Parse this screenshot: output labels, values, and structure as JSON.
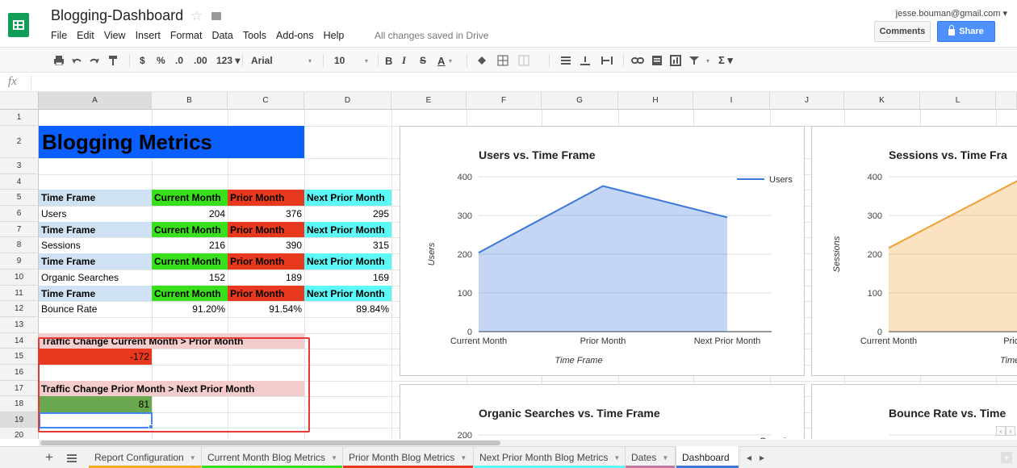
{
  "app": {
    "title": "Blogging-Dashboard",
    "star_icon": "star-icon",
    "folder_icon": "folder-icon",
    "menus": [
      "File",
      "Edit",
      "View",
      "Insert",
      "Format",
      "Data",
      "Tools",
      "Add-ons",
      "Help"
    ],
    "save_status": "All changes saved in Drive",
    "account_email": "jesse.bouman@gmail.com ▾",
    "comments_label": "Comments",
    "share_label": "Share"
  },
  "toolbar": {
    "currency": "$",
    "percent": "%",
    "decimal_less": ".0",
    "decimal_more": ".00",
    "number_format": "123 ▾",
    "font": "Arial",
    "font_size": "10",
    "bold": "B",
    "italic": "I",
    "strike": "S",
    "text_color": "A",
    "sum": "Σ ▾"
  },
  "formula_bar": {
    "label": "fx",
    "value": ""
  },
  "columns": [
    "A",
    "B",
    "C",
    "D",
    "E",
    "F",
    "G",
    "H",
    "I",
    "J",
    "K",
    "L"
  ],
  "rows": [
    "1",
    "2",
    "3",
    "4",
    "5",
    "6",
    "7",
    "8",
    "9",
    "10",
    "11",
    "12",
    "13",
    "14",
    "15",
    "16",
    "17",
    "18",
    "19",
    "20"
  ],
  "colors": {
    "title_bg": "#0b5ffd",
    "header_blue": "#cfe2f3",
    "current_green": "#38e01b",
    "prior_red": "#e8391e",
    "next_cyan": "#5cf9f7",
    "traffic_label_bg": "#f4cccc",
    "negative_bg": "#e8391e",
    "positive_bg": "#6aa84f",
    "highlight_border": "#e53935",
    "users_line": "#3c78d8",
    "sessions_line": "#f1a033",
    "organic_legend": "#9c27b0"
  },
  "sheet": {
    "title": "Blogging Metrics",
    "header_time_frame": "Time Frame",
    "header_current": "Current Month",
    "header_prior": "Prior Month",
    "header_next": "Next Prior Month",
    "metrics": [
      {
        "name": "Users",
        "current": "204",
        "prior": "376",
        "next": "295"
      },
      {
        "name": "Sessions",
        "current": "216",
        "prior": "390",
        "next": "315"
      },
      {
        "name": "Organic Searches",
        "current": "152",
        "prior": "189",
        "next": "169"
      },
      {
        "name": "Bounce Rate",
        "current": "91.20%",
        "prior": "91.54%",
        "next": "89.84%"
      }
    ],
    "traffic_change_1_label": "Traffic Change Current Month > Prior Month",
    "traffic_change_1_value": "-172",
    "traffic_change_2_label": "Traffic Change Prior Month > Next Prior Month",
    "traffic_change_2_value": "81"
  },
  "chart_data": [
    {
      "type": "area",
      "title": "Users vs. Time Frame",
      "xlabel": "Time Frame",
      "ylabel": "Users",
      "categories": [
        "Current Month",
        "Prior Month",
        "Next Prior Month"
      ],
      "series": [
        {
          "name": "Users",
          "values": [
            204,
            376,
            295
          ],
          "color": "#3c78d8"
        }
      ],
      "ylim": [
        0,
        400
      ],
      "yticks": [
        0,
        100,
        200,
        300,
        400
      ],
      "grid": true,
      "legend": "right"
    },
    {
      "type": "area",
      "title": "Sessions vs. Time Fra",
      "xlabel": "Time F",
      "ylabel": "Sessions",
      "categories": [
        "Current Month",
        "Prior M"
      ],
      "series": [
        {
          "values": [
            216,
            390
          ],
          "color": "#f1a033"
        }
      ],
      "ylim": [
        0,
        400
      ],
      "yticks": [
        0,
        100,
        200,
        300,
        400
      ],
      "grid": true
    },
    {
      "type": "line",
      "title": "Organic Searches vs. Time Frame",
      "ytick_top": "200",
      "legend_label": "Organic"
    },
    {
      "type": "line",
      "title": "Bounce Rate vs. Time"
    }
  ],
  "tabs": [
    {
      "label": "Report Configuration",
      "color": "#f6a623"
    },
    {
      "label": "Current Month Blog Metrics",
      "color": "#38e01b"
    },
    {
      "label": "Prior Month Blog Metrics",
      "color": "#e8391e"
    },
    {
      "label": "Next Prior Month Blog Metrics",
      "color": "#5cf9f7"
    },
    {
      "label": "Dates",
      "color": "#c27ba0"
    },
    {
      "label": "Dashboard",
      "color": "#3c78d8"
    }
  ]
}
